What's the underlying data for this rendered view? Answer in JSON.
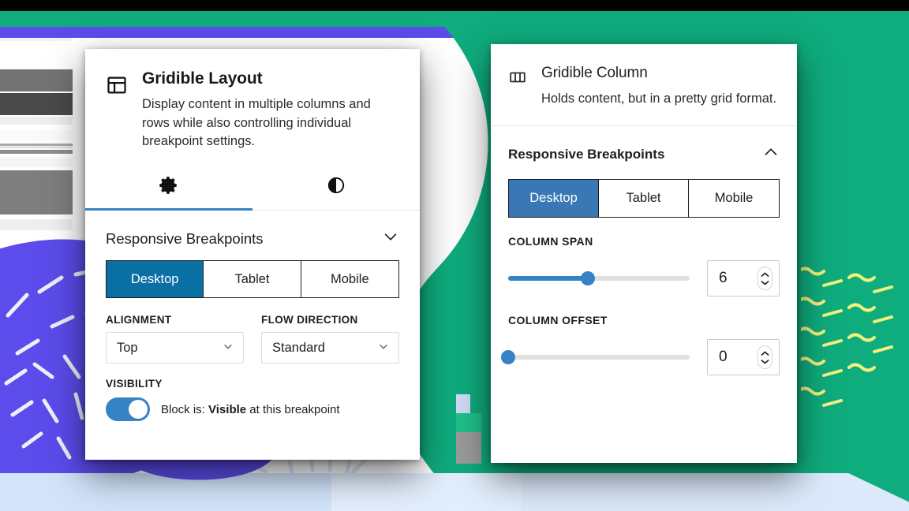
{
  "theme": {
    "accent_blue": "#3582c4",
    "left_active_blue": "#0a6fa3",
    "right_active_blue": "#3a77b5",
    "green": "#0fac7d",
    "purple": "#5b4ceb",
    "light_blue_band": "#d9e8fb",
    "yellow_green": "#c8f178",
    "wave_yellow": "#f0f07a"
  },
  "left_panel": {
    "icon": "layout-icon",
    "title": "Gridible Layout",
    "description": "Display content in multiple columns and rows while also controlling individual breakpoint settings.",
    "tabs": [
      {
        "icon": "gear-icon",
        "name": "settings",
        "active": true
      },
      {
        "icon": "contrast-icon",
        "name": "styles",
        "active": false
      }
    ],
    "section": {
      "title": "Responsive Breakpoints",
      "chevron": "chevron-down-icon",
      "expanded": true
    },
    "breakpoints": [
      "Desktop",
      "Tablet",
      "Mobile"
    ],
    "breakpoint_selected": "Desktop",
    "alignment": {
      "label": "ALIGNMENT",
      "value": "Top",
      "chevron": "chevron-down-icon"
    },
    "flow_direction": {
      "label": "FLOW DIRECTION",
      "value": "Standard",
      "chevron": "chevron-down-icon"
    },
    "visibility": {
      "label": "VISIBILITY",
      "toggle_on": true,
      "text_prefix": "Block is:",
      "text_strong": "Visible",
      "text_suffix": "at this breakpoint"
    }
  },
  "right_panel": {
    "icon": "columns-icon",
    "title": "Gridible Column",
    "description": "Holds content, but in a pretty grid format.",
    "section": {
      "title": "Responsive Breakpoints",
      "chevron": "chevron-up-icon",
      "expanded": true
    },
    "breakpoints": [
      "Desktop",
      "Tablet",
      "Mobile"
    ],
    "breakpoint_selected": "Desktop",
    "column_span": {
      "label": "COLUMN SPAN",
      "value": "6",
      "percent": 44
    },
    "column_offset": {
      "label": "COLUMN OFFSET",
      "value": "0",
      "percent": 0
    }
  }
}
